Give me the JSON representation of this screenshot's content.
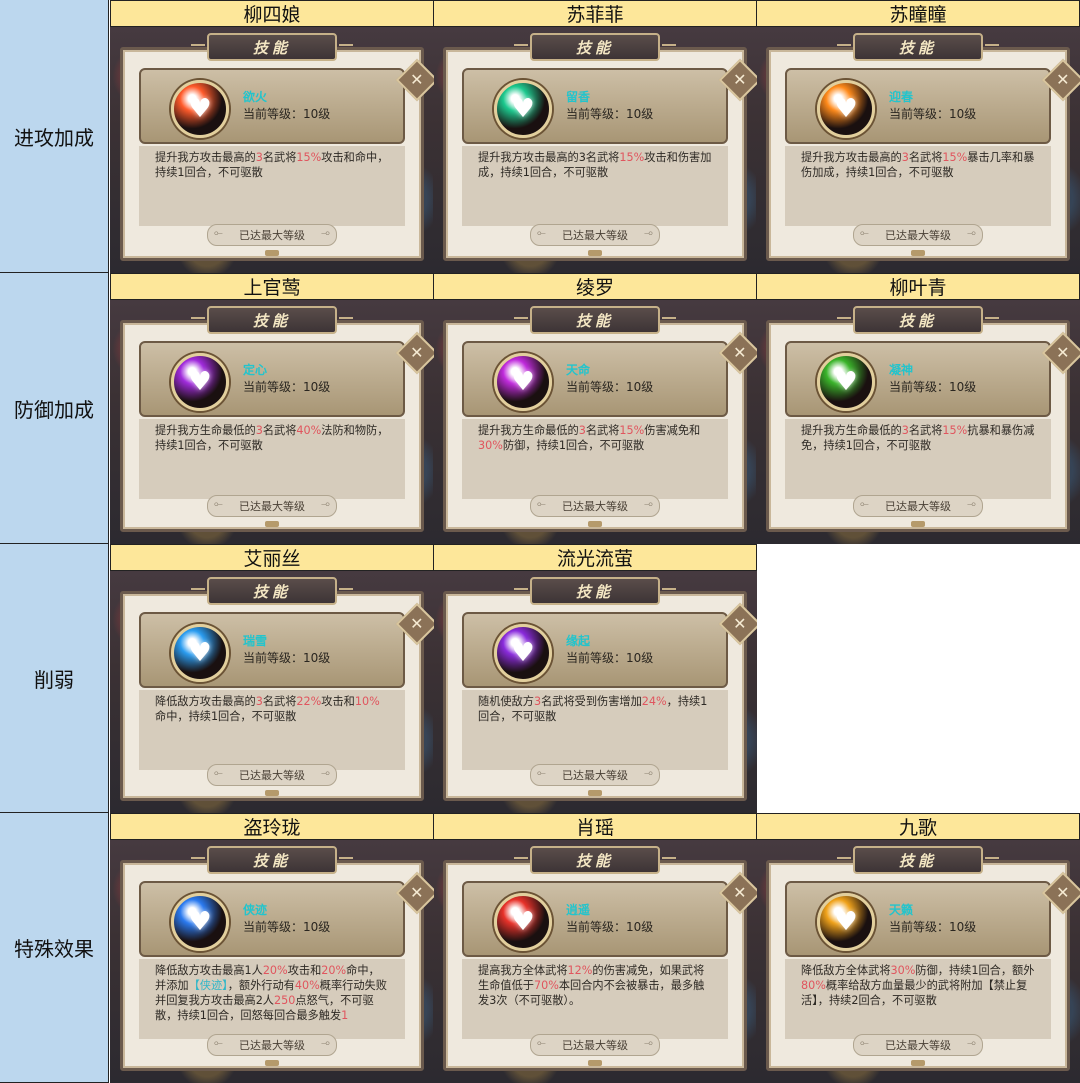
{
  "categories": [
    {
      "label": "进攻加成"
    },
    {
      "label": "防御加成"
    },
    {
      "label": "削弱"
    },
    {
      "label": "特殊效果"
    }
  ],
  "common": {
    "skill_tab": "技能",
    "max_level_button": "已达最大等级",
    "close_glyph": "✕"
  },
  "cards": [
    {
      "name": "柳四娘",
      "skill": "欲火",
      "level": "当前等级：10级",
      "gem_color": "#ff5a2a",
      "gem_glyph": "♥",
      "desc": [
        [
          "提升我方攻击最高的",
          ""
        ],
        [
          "3",
          "hl"
        ],
        [
          "名武将",
          ""
        ],
        [
          "15%",
          "hl"
        ],
        [
          "攻击和命中，持续1回合，不可驱散",
          ""
        ]
      ]
    },
    {
      "name": "苏菲菲",
      "skill": "留香",
      "level": "当前等级：10级",
      "gem_color": "#1cc98e",
      "gem_glyph": "♥",
      "desc": [
        [
          "提升我方攻击最高的3名武将",
          ""
        ],
        [
          "15%",
          "hl"
        ],
        [
          "攻击和伤害加成，持续1回合，不可驱散",
          ""
        ]
      ]
    },
    {
      "name": "苏瞳瞳",
      "skill": "迎春",
      "level": "当前等级：10级",
      "gem_color": "#ff8a1a",
      "gem_glyph": "♥",
      "desc": [
        [
          "提升我方攻击最高的",
          ""
        ],
        [
          "3",
          "hl"
        ],
        [
          "名武将",
          ""
        ],
        [
          "15%",
          "hl"
        ],
        [
          "暴击几率和暴伤加成，持续1回合，不可驱散",
          ""
        ]
      ]
    },
    {
      "name": "上官莺",
      "skill": "定心",
      "level": "当前等级：10级",
      "gem_color": "#a02bdc",
      "gem_glyph": "♥",
      "desc": [
        [
          "提升我方生命最低的",
          ""
        ],
        [
          "3",
          "hl"
        ],
        [
          "名武将",
          ""
        ],
        [
          "40%",
          "hl"
        ],
        [
          "法防和物防，持续1回合，不可驱散",
          ""
        ]
      ]
    },
    {
      "name": "绫罗",
      "skill": "天命",
      "level": "当前等级：10级",
      "gem_color": "#c02bdc",
      "gem_glyph": "♥",
      "desc": [
        [
          "提升我方生命最低的",
          ""
        ],
        [
          "3",
          "hl"
        ],
        [
          "名武将",
          ""
        ],
        [
          "15%",
          "hl"
        ],
        [
          "伤害减免和",
          ""
        ],
        [
          "30%",
          "hl"
        ],
        [
          "防御，持续1回合，不可驱散",
          ""
        ]
      ]
    },
    {
      "name": "柳叶青",
      "skill": "凝神",
      "level": "当前等级：10级",
      "gem_color": "#3ab42a",
      "gem_glyph": "♥",
      "desc": [
        [
          "提升我方生命最低的",
          ""
        ],
        [
          "3",
          "hl"
        ],
        [
          "名武将",
          ""
        ],
        [
          "15%",
          "hl"
        ],
        [
          "抗暴和暴伤减免，持续1回合，不可驱散",
          ""
        ]
      ]
    },
    {
      "name": "艾丽丝",
      "skill": "瑞雪",
      "level": "当前等级：10级",
      "gem_color": "#2a9cf0",
      "gem_glyph": "♥",
      "desc": [
        [
          "降低敌方攻击最高的",
          ""
        ],
        [
          "3",
          "hl"
        ],
        [
          "名武将",
          ""
        ],
        [
          "22%",
          "hl"
        ],
        [
          "攻击和",
          ""
        ],
        [
          "10%",
          "hl"
        ],
        [
          "命中，持续1回合，不可驱散",
          ""
        ]
      ]
    },
    {
      "name": "流光流萤",
      "skill": "缘起",
      "level": "当前等级：10级",
      "gem_color": "#8a2bdc",
      "gem_glyph": "♥",
      "desc": [
        [
          "随机使敌方",
          ""
        ],
        [
          "3",
          "hl"
        ],
        [
          "名武将受到伤害增加",
          ""
        ],
        [
          "24%",
          "hl"
        ],
        [
          "，持续1回合，不可驱散",
          ""
        ]
      ]
    },
    {
      "name": "盗玲珑",
      "skill": "侠迹",
      "level": "当前等级：10级",
      "gem_color": "#2a7af0",
      "gem_glyph": "♥",
      "desc": [
        [
          "降低敌方攻击最高1人",
          ""
        ],
        [
          "20%",
          "hl"
        ],
        [
          "攻击和",
          ""
        ],
        [
          "20%",
          "hl"
        ],
        [
          "命中，并添加",
          ""
        ],
        [
          "【侠迹】",
          "tag"
        ],
        [
          "，额外行动有",
          ""
        ],
        [
          "40%",
          "hl"
        ],
        [
          "概率行动失败并回复我方攻击最高2人",
          ""
        ],
        [
          "250",
          "hl"
        ],
        [
          "点怒气，不可驱散，持续1回合，回怒每回合最多触发",
          ""
        ],
        [
          "1",
          "hl"
        ]
      ]
    },
    {
      "name": "肖瑶",
      "skill": "逍遥",
      "level": "当前等级：10级",
      "gem_color": "#e8322a",
      "gem_glyph": "♥",
      "desc": [
        [
          "提高我方全体武将",
          ""
        ],
        [
          "12%",
          "hl"
        ],
        [
          "的伤害减免，如果武将生命值低于",
          ""
        ],
        [
          "70%",
          "hl"
        ],
        [
          "本回合内不会被暴击，最多触发3次（不可驱散）。",
          ""
        ]
      ]
    },
    {
      "name": "九歌",
      "skill": "天籁",
      "level": "当前等级：10级",
      "gem_color": "#f0a21a",
      "gem_glyph": "♥",
      "desc": [
        [
          "降低敌方全体武将",
          ""
        ],
        [
          "30%",
          "hl"
        ],
        [
          "防御，持续1回合，额外",
          ""
        ],
        [
          "80%",
          "hl"
        ],
        [
          "概率给敌方血量最少的武将附加【禁止复活】，持续2回合，不可驱散",
          ""
        ]
      ]
    }
  ]
}
